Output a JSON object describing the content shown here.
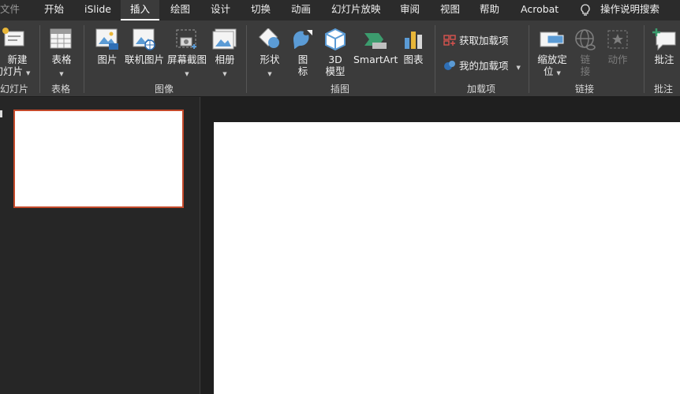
{
  "menu": {
    "tabs": [
      "文件",
      "开始",
      "iSlide",
      "插入",
      "绘图",
      "设计",
      "切换",
      "动画",
      "幻灯片放映",
      "审阅",
      "视图",
      "帮助",
      "Acrobat"
    ],
    "active_tab": "插入",
    "tell_me": "操作说明搜索"
  },
  "ribbon": {
    "new_slide": {
      "line1": "新建",
      "line2": "幻灯片"
    },
    "table": {
      "label": "表格"
    },
    "pictures": {
      "label": "图片"
    },
    "online_pictures": {
      "label": "联机图片"
    },
    "screenshot": {
      "label": "屏幕截图"
    },
    "album": {
      "label": "相册"
    },
    "shapes": {
      "label": "形状"
    },
    "icons": {
      "line1": "图",
      "line2": "标"
    },
    "model3d": {
      "line1": "3D",
      "line2": "模型"
    },
    "smartart": {
      "label": "SmartArt"
    },
    "chart": {
      "label": "图表"
    },
    "get_addins": {
      "label": "获取加载项"
    },
    "my_addins": {
      "label": "我的加载项"
    },
    "zoom": {
      "line1": "缩放定",
      "line2": "位"
    },
    "link": {
      "line1": "链",
      "line2": "接"
    },
    "action": {
      "label": "动作"
    },
    "comment": {
      "label": "批注"
    },
    "groups": {
      "slides": "幻灯片",
      "tables": "表格",
      "images": "图像",
      "illustrations": "插图",
      "addins": "加载项",
      "links": "链接",
      "comments": "批注"
    }
  },
  "colors": {
    "accent": "#c4492a",
    "ribbon_bg": "#3b3b3b",
    "menubar_bg": "#2b2b2b"
  }
}
